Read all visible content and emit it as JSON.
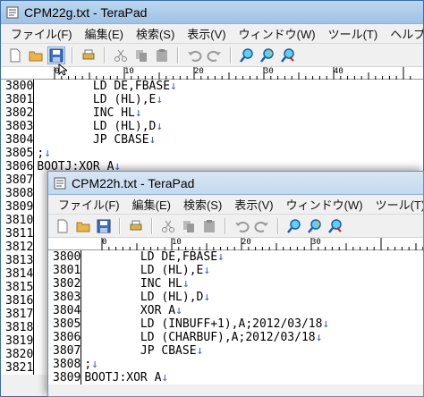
{
  "colors": {
    "eol": "#3c5fd6",
    "titlebar": "#9fc2e6",
    "desktop": "#2a6fb3"
  },
  "eol_mark": "↓",
  "back_window": {
    "title": "CPM22g.txt - TeraPad",
    "menu": [
      "ファイル(F)",
      "編集(E)",
      "検索(S)",
      "表示(V)",
      "ウィンドウ(W)",
      "ツール(T)",
      "ヘルプ(H)"
    ],
    "ruler_marks": [
      "0",
      "10",
      "20",
      "30",
      "40"
    ],
    "lines": [
      {
        "num": "3800",
        "text": "        LD DE,FBASE",
        "eol": true
      },
      {
        "num": "3801",
        "text": "        LD (HL),E",
        "eol": true
      },
      {
        "num": "3802",
        "text": "        INC HL",
        "eol": true
      },
      {
        "num": "3803",
        "text": "        LD (HL),D",
        "eol": true
      },
      {
        "num": "3804",
        "text": "        JP CBASE",
        "eol": true
      },
      {
        "num": "3805",
        "text": ";",
        "eol": true
      },
      {
        "num": "3806",
        "text": "BOOTJ:XOR A",
        "eol": true
      },
      {
        "num": "3807",
        "text": "",
        "eol": false
      },
      {
        "num": "3808",
        "text": "",
        "eol": false
      },
      {
        "num": "3809",
        "text": "",
        "eol": false
      },
      {
        "num": "3810",
        "text": "",
        "eol": false
      },
      {
        "num": "3811",
        "text": "",
        "eol": false
      },
      {
        "num": "3812",
        "text": "",
        "eol": false
      },
      {
        "num": "3813",
        "text": "",
        "eol": false
      },
      {
        "num": "3814",
        "text": "",
        "eol": false
      },
      {
        "num": "3815",
        "text": "",
        "eol": false
      },
      {
        "num": "3816",
        "text": "",
        "eol": false
      },
      {
        "num": "3817",
        "text": "",
        "eol": false
      },
      {
        "num": "3818",
        "text": "",
        "eol": false
      },
      {
        "num": "3819",
        "text": "",
        "eol": false
      },
      {
        "num": "3820",
        "text": "",
        "eol": false
      },
      {
        "num": "3821",
        "text": "",
        "eol": false
      }
    ]
  },
  "front_window": {
    "title": "CPM22h.txt - TeraPad",
    "menu": [
      "ファイル(F)",
      "編集(E)",
      "検索(S)",
      "表示(V)",
      "ウィンドウ(W)",
      "ツール(T)"
    ],
    "ruler_marks": [
      "0",
      "10",
      "20",
      "30"
    ],
    "lines": [
      {
        "num": "3800",
        "text": "        LD DE,FBASE",
        "eol": true
      },
      {
        "num": "3801",
        "text": "        LD (HL),E",
        "eol": true
      },
      {
        "num": "3802",
        "text": "        INC HL",
        "eol": true
      },
      {
        "num": "3803",
        "text": "        LD (HL),D",
        "eol": true
      },
      {
        "num": "3804",
        "text": "        XOR A",
        "eol": true
      },
      {
        "num": "3805",
        "text": "        LD (INBUFF+1),A;2012/03/18",
        "eol": true
      },
      {
        "num": "3806",
        "text": "        LD (CHARBUF),A;2012/03/18",
        "eol": true
      },
      {
        "num": "3807",
        "text": "        JP CBASE",
        "eol": true
      },
      {
        "num": "3808",
        "text": ";",
        "eol": true
      },
      {
        "num": "3809",
        "text": "BOOTJ:XOR A",
        "eol": true
      }
    ]
  }
}
